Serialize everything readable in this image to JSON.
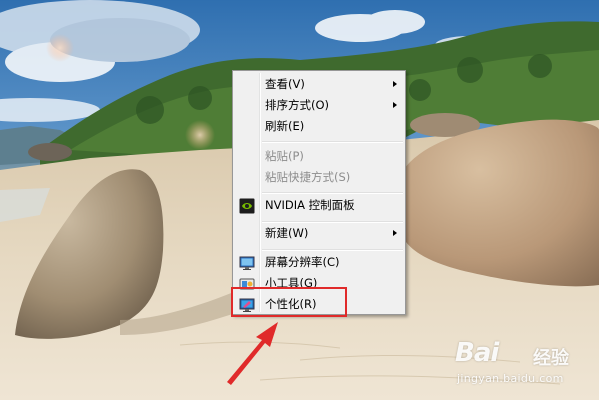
{
  "context_menu": {
    "items": [
      {
        "label": "查看(V)",
        "submenu": true,
        "enabled": true
      },
      {
        "label": "排序方式(O)",
        "submenu": true,
        "enabled": true
      },
      {
        "label": "刷新(E)",
        "submenu": false,
        "enabled": true
      },
      {
        "label": "粘贴(P)",
        "submenu": false,
        "enabled": false
      },
      {
        "label": "粘贴快捷方式(S)",
        "submenu": false,
        "enabled": false
      },
      {
        "label": "NVIDIA 控制面板",
        "submenu": false,
        "enabled": true,
        "icon": "nvidia-icon"
      },
      {
        "label": "新建(W)",
        "submenu": true,
        "enabled": true
      },
      {
        "label": "屏幕分辨率(C)",
        "submenu": false,
        "enabled": true,
        "icon": "display-resolution-icon"
      },
      {
        "label": "小工具(G)",
        "submenu": false,
        "enabled": true,
        "icon": "gadgets-icon"
      },
      {
        "label": "个性化(R)",
        "submenu": false,
        "enabled": true,
        "icon": "personalize-icon",
        "highlighted": true
      }
    ]
  },
  "annotation": {
    "highlight_color": "#e02a2a"
  },
  "watermark": {
    "brand": "Bai",
    "brand_cn": "经验",
    "url": "jingyan.baidu.com"
  }
}
